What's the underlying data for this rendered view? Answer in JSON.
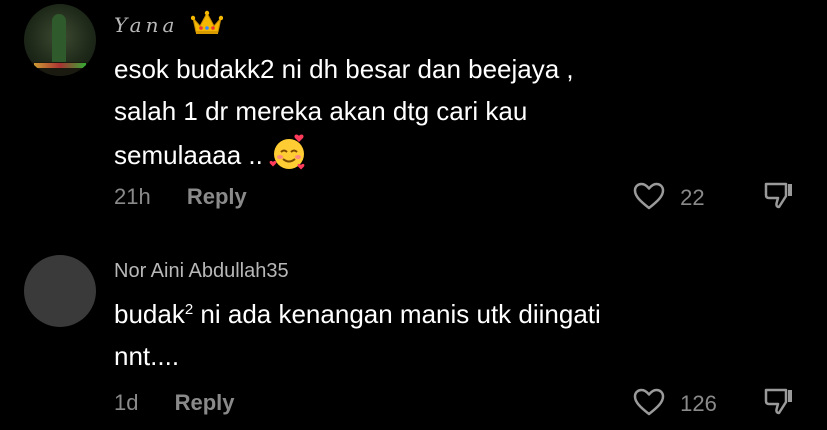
{
  "comments": [
    {
      "username": "Yana",
      "text_lines": [
        "esok budakk2 ni dh besar dan beejaya ,",
        "salah 1 dr mereka akan dtg cari kau",
        "semulaaaa .."
      ],
      "emoji": "smiling-face-with-hearts",
      "time": "21h",
      "reply_label": "Reply",
      "likes": "22"
    },
    {
      "username": "Nor Aini Abdullah35",
      "text_line1_pre": "budak",
      "text_line1_sup": "2",
      "text_line1_post": " ni ada kenangan manis utk diingati",
      "text_line2": "nnt....",
      "time": "1d",
      "reply_label": "Reply",
      "likes": "126"
    }
  ],
  "colors": {
    "background": "#000000",
    "text": "#ffffff",
    "muted": "#8a8a8a"
  }
}
